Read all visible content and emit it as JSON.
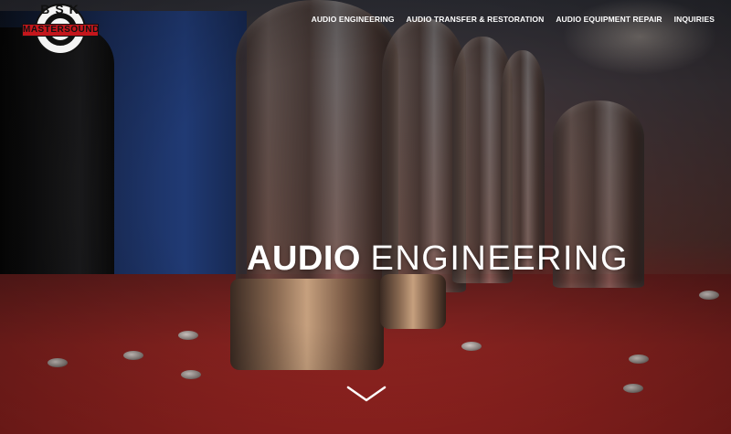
{
  "logo": {
    "letters": "BSK",
    "banner": "MASTERSOUND",
    "colors": {
      "banner": "#c4161c",
      "disc": "#f4f4f4"
    }
  },
  "nav": {
    "items": [
      {
        "label": "AUDIO ENGINEERING"
      },
      {
        "label": "AUDIO TRANSFER & RESTORATION"
      },
      {
        "label": "AUDIO EQUIPMENT REPAIR"
      },
      {
        "label": "INQUIRIES"
      }
    ]
  },
  "hero": {
    "title_bold": "AUDIO",
    "title_light": "ENGINEERING",
    "scroll_icon": "chevron-down-icon"
  },
  "colors": {
    "nav_text": "#ffffff",
    "table_red": "#8a2320",
    "blue_block": "#203a74"
  }
}
